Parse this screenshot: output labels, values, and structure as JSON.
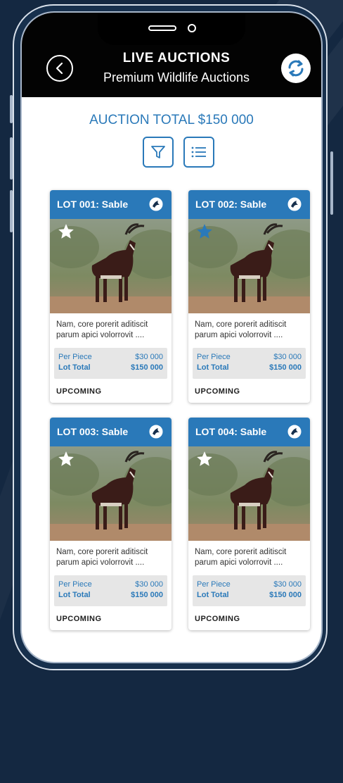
{
  "header": {
    "title": "LIVE AUCTIONS",
    "subtitle": "Premium Wildlife Auctions"
  },
  "auction_total": "AUCTION TOTAL $150 000",
  "toolbar": {
    "filter_icon": "filter-icon",
    "list_icon": "list-icon"
  },
  "colors": {
    "accent": "#2a79b9",
    "header_bg": "#030303",
    "background": "#142841",
    "starred": "#2a79b9"
  },
  "lots": [
    {
      "title": "LOT 001: Sable",
      "description": "Nam, core porerit aditiscit parum apici volorrovit ....",
      "per_piece_label": "Per Piece",
      "per_piece": "$30 000",
      "lot_total_label": "Lot Total",
      "lot_total": "$150 000",
      "status": "UPCOMING",
      "starred": false
    },
    {
      "title": "LOT 002: Sable",
      "description": "Nam, core porerit aditiscit parum apici volorrovit ....",
      "per_piece_label": "Per Piece",
      "per_piece": "$30 000",
      "lot_total_label": "Lot Total",
      "lot_total": "$150 000",
      "status": "UPCOMING",
      "starred": true
    },
    {
      "title": "LOT 003: Sable",
      "description": "Nam, core porerit aditiscit parum apici volorrovit ....",
      "per_piece_label": "Per Piece",
      "per_piece": "$30 000",
      "lot_total_label": "Lot Total",
      "lot_total": "$150 000",
      "status": "UPCOMING",
      "starred": false
    },
    {
      "title": "LOT 004: Sable",
      "description": "Nam, core porerit aditiscit parum apici volorrovit ....",
      "per_piece_label": "Per Piece",
      "per_piece": "$30 000",
      "lot_total_label": "Lot Total",
      "lot_total": "$150 000",
      "status": "UPCOMING",
      "starred": false
    }
  ]
}
